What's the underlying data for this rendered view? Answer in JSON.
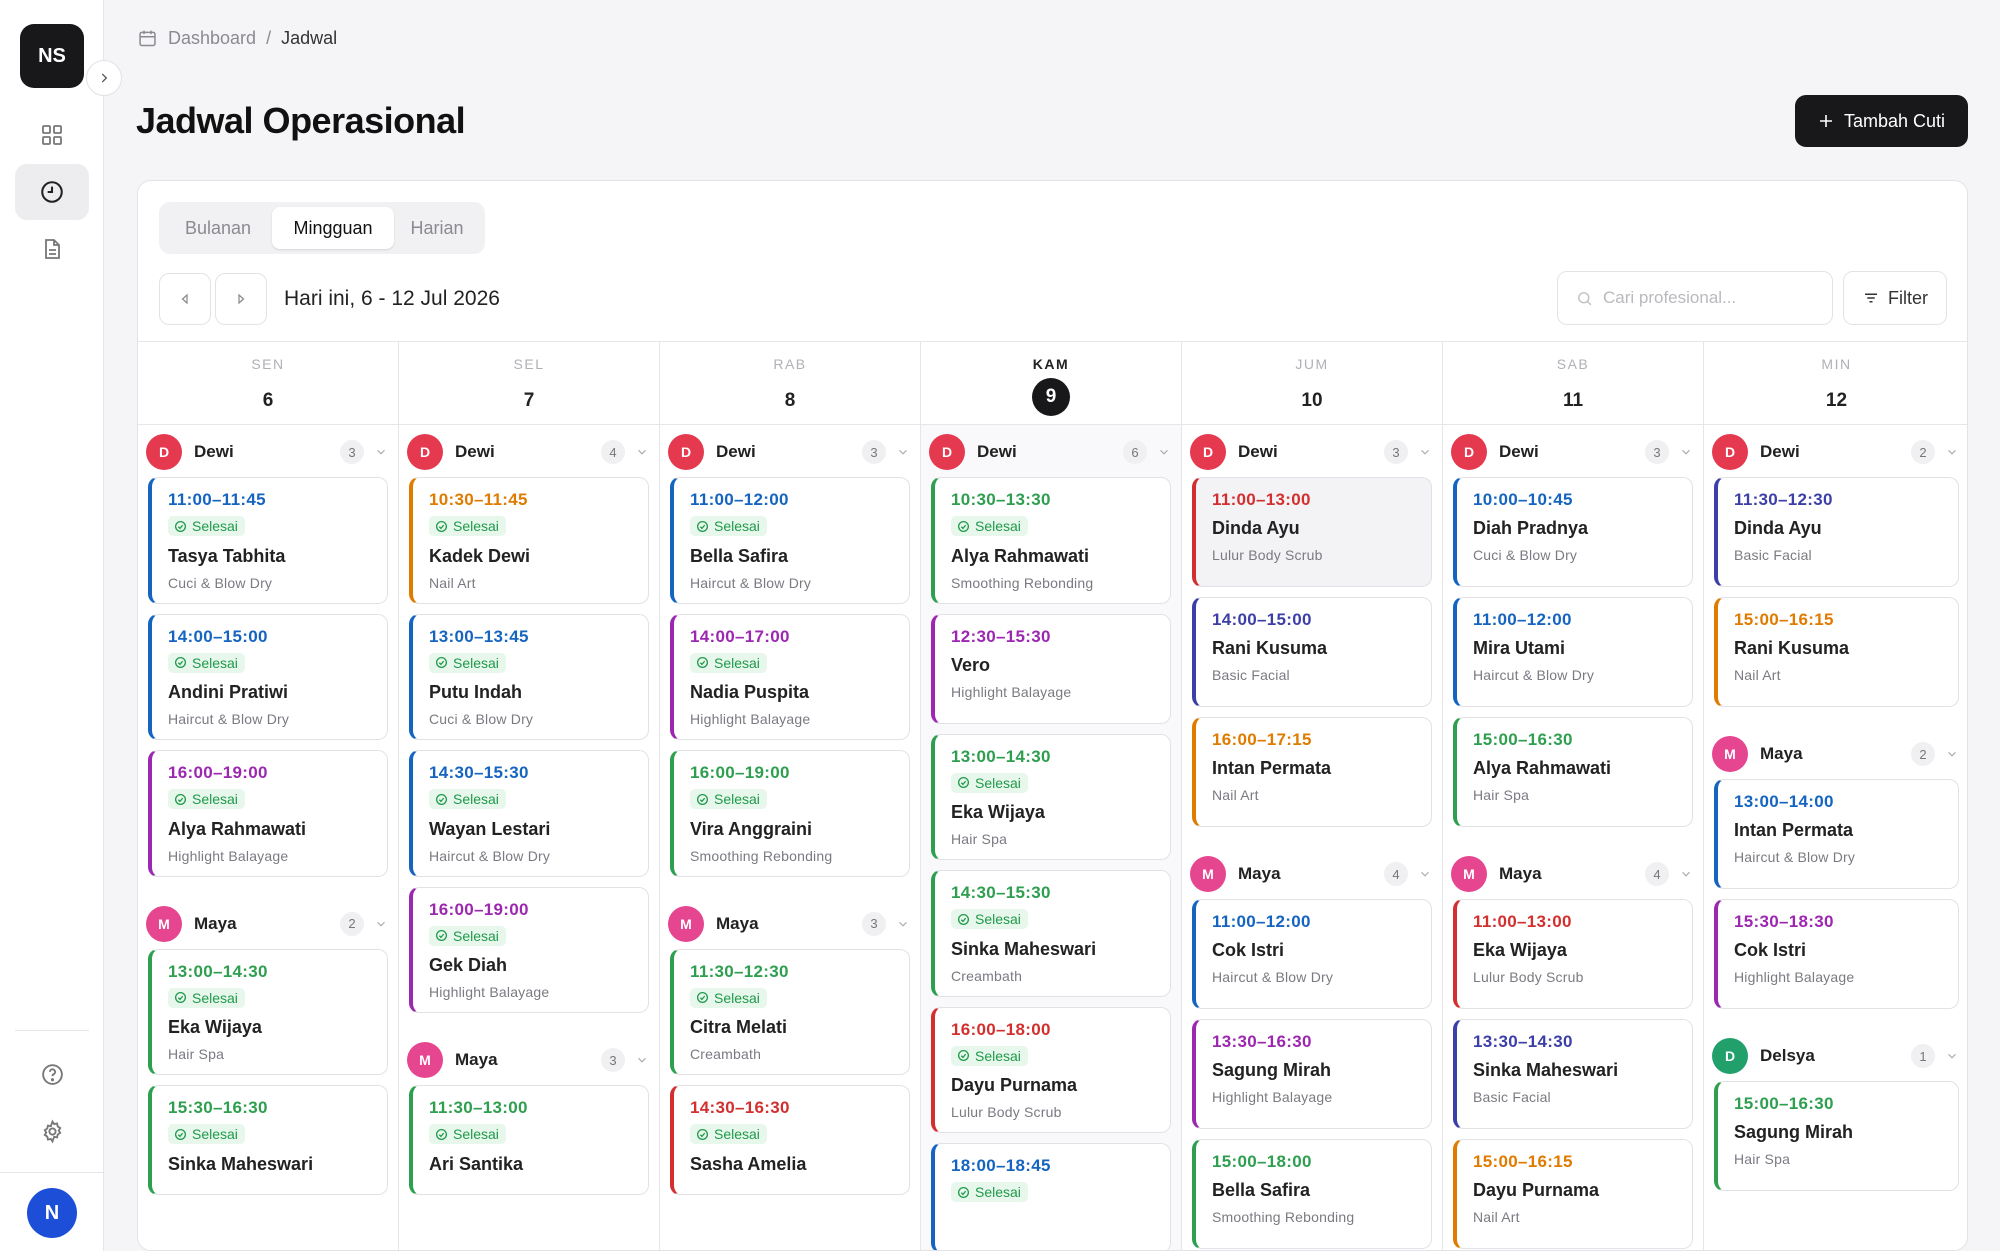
{
  "app": {
    "initials": "NS",
    "user_initial": "N"
  },
  "breadcrumb": {
    "root": "Dashboard",
    "separator": "/",
    "current": "Jadwal"
  },
  "header": {
    "title": "Jadwal Operasional",
    "add_label": "Tambah Cuti"
  },
  "view_tabs": [
    {
      "label": "Bulanan",
      "active": false
    },
    {
      "label": "Mingguan",
      "active": true
    },
    {
      "label": "Harian",
      "active": false
    }
  ],
  "toolbar": {
    "range_label": "Hari ini, 6 - 12 Jul 2026",
    "search_placeholder": "Cari profesional...",
    "filter_label": "Filter"
  },
  "status_label": "Selesai",
  "colors": {
    "blue": "#1565c0",
    "orange": "#e07b00",
    "purple": "#9c27b0",
    "green": "#2e9e4f",
    "indigo": "#3d3fa8",
    "red": "#d32f2f",
    "teal": "#1f8a6f",
    "avatar_dewi": "#e53950",
    "avatar_maya": "#e6458f",
    "avatar_delsya": "#22a06b"
  },
  "days": [
    {
      "dow": "SEN",
      "num": "6",
      "today": false,
      "groups": [
        {
          "name": "Dewi",
          "initial": "D",
          "count": "3",
          "avatar": "avatar_dewi",
          "items": [
            {
              "time": "11:00–11:45",
              "status": true,
              "client": "Tasya Tabhita",
              "service": "Cuci & Blow Dry",
              "color": "blue"
            },
            {
              "time": "14:00–15:00",
              "status": true,
              "client": "Andini Pratiwi",
              "service": "Haircut & Blow Dry",
              "color": "blue"
            },
            {
              "time": "16:00–19:00",
              "status": true,
              "client": "Alya Rahmawati",
              "service": "Highlight Balayage",
              "color": "purple"
            }
          ]
        },
        {
          "name": "Maya",
          "initial": "M",
          "count": "2",
          "avatar": "avatar_maya",
          "items": [
            {
              "time": "13:00–14:30",
              "status": true,
              "client": "Eka Wijaya",
              "service": "Hair Spa",
              "color": "green"
            },
            {
              "time": "15:30–16:30",
              "status": true,
              "client": "Sinka Maheswari",
              "service": "",
              "color": "green"
            }
          ]
        }
      ]
    },
    {
      "dow": "SEL",
      "num": "7",
      "today": false,
      "groups": [
        {
          "name": "Dewi",
          "initial": "D",
          "count": "4",
          "avatar": "avatar_dewi",
          "items": [
            {
              "time": "10:30–11:45",
              "status": true,
              "client": "Kadek Dewi",
              "service": "Nail Art",
              "color": "orange"
            },
            {
              "time": "13:00–13:45",
              "status": true,
              "client": "Putu Indah",
              "service": "Cuci & Blow Dry",
              "color": "blue"
            },
            {
              "time": "14:30–15:30",
              "status": true,
              "client": "Wayan Lestari",
              "service": "Haircut & Blow Dry",
              "color": "blue"
            },
            {
              "time": "16:00–19:00",
              "status": true,
              "client": "Gek Diah",
              "service": "Highlight Balayage",
              "color": "purple"
            }
          ]
        },
        {
          "name": "Maya",
          "initial": "M",
          "count": "3",
          "avatar": "avatar_maya",
          "items": [
            {
              "time": "11:30–13:00",
              "status": true,
              "client": "Ari Santika",
              "service": "",
              "color": "green"
            }
          ]
        }
      ]
    },
    {
      "dow": "RAB",
      "num": "8",
      "today": false,
      "groups": [
        {
          "name": "Dewi",
          "initial": "D",
          "count": "3",
          "avatar": "avatar_dewi",
          "items": [
            {
              "time": "11:00–12:00",
              "status": true,
              "client": "Bella Safira",
              "service": "Haircut & Blow Dry",
              "color": "blue"
            },
            {
              "time": "14:00–17:00",
              "status": true,
              "client": "Nadia Puspita",
              "service": "Highlight Balayage",
              "color": "purple"
            },
            {
              "time": "16:00–19:00",
              "status": true,
              "client": "Vira Anggraini",
              "service": "Smoothing Rebonding",
              "color": "green"
            }
          ]
        },
        {
          "name": "Maya",
          "initial": "M",
          "count": "3",
          "avatar": "avatar_maya",
          "items": [
            {
              "time": "11:30–12:30",
              "status": true,
              "client": "Citra Melati",
              "service": "Creambath",
              "color": "green"
            },
            {
              "time": "14:30–16:30",
              "status": true,
              "client": "Sasha Amelia",
              "service": "",
              "color": "red"
            }
          ]
        }
      ]
    },
    {
      "dow": "KAM",
      "num": "9",
      "today": true,
      "groups": [
        {
          "name": "Dewi",
          "initial": "D",
          "count": "6",
          "avatar": "avatar_dewi",
          "items": [
            {
              "time": "10:30–13:30",
              "status": true,
              "client": "Alya Rahmawati",
              "service": "Smoothing Rebonding",
              "color": "green"
            },
            {
              "time": "12:30–15:30",
              "status": false,
              "client": "Vero",
              "service": "Highlight Balayage",
              "color": "purple"
            },
            {
              "time": "13:00–14:30",
              "status": true,
              "client": "Eka Wijaya",
              "service": "Hair Spa",
              "color": "green"
            },
            {
              "time": "14:30–15:30",
              "status": true,
              "client": "Sinka Maheswari",
              "service": "Creambath",
              "color": "green"
            },
            {
              "time": "16:00–18:00",
              "status": true,
              "client": "Dayu Purnama",
              "service": "Lulur Body Scrub",
              "color": "red"
            },
            {
              "time": "18:00–18:45",
              "status": true,
              "client": "",
              "service": "",
              "color": "blue"
            }
          ]
        }
      ]
    },
    {
      "dow": "JUM",
      "num": "10",
      "today": false,
      "groups": [
        {
          "name": "Dewi",
          "initial": "D",
          "count": "3",
          "avatar": "avatar_dewi",
          "items": [
            {
              "time": "11:00–13:00",
              "status": false,
              "client": "Dinda Ayu",
              "service": "Lulur Body Scrub",
              "color": "red",
              "dim": true
            },
            {
              "time": "14:00–15:00",
              "status": false,
              "client": "Rani Kusuma",
              "service": "Basic Facial",
              "color": "indigo"
            },
            {
              "time": "16:00–17:15",
              "status": false,
              "client": "Intan Permata",
              "service": "Nail Art",
              "color": "orange"
            }
          ]
        },
        {
          "name": "Maya",
          "initial": "M",
          "count": "4",
          "avatar": "avatar_maya",
          "items": [
            {
              "time": "11:00–12:00",
              "status": false,
              "client": "Cok Istri",
              "service": "Haircut & Blow Dry",
              "color": "blue"
            },
            {
              "time": "13:30–16:30",
              "status": false,
              "client": "Sagung Mirah",
              "service": "Highlight Balayage",
              "color": "purple"
            },
            {
              "time": "15:00–18:00",
              "status": false,
              "client": "Bella Safira",
              "service": "Smoothing Rebonding",
              "color": "green"
            }
          ]
        }
      ]
    },
    {
      "dow": "SAB",
      "num": "11",
      "today": false,
      "groups": [
        {
          "name": "Dewi",
          "initial": "D",
          "count": "3",
          "avatar": "avatar_dewi",
          "items": [
            {
              "time": "10:00–10:45",
              "status": false,
              "client": "Diah Pradnya",
              "service": "Cuci & Blow Dry",
              "color": "blue"
            },
            {
              "time": "11:00–12:00",
              "status": false,
              "client": "Mira Utami",
              "service": "Haircut & Blow Dry",
              "color": "blue"
            },
            {
              "time": "15:00–16:30",
              "status": false,
              "client": "Alya Rahmawati",
              "service": "Hair Spa",
              "color": "green"
            }
          ]
        },
        {
          "name": "Maya",
          "initial": "M",
          "count": "4",
          "avatar": "avatar_maya",
          "items": [
            {
              "time": "11:00–13:00",
              "status": false,
              "client": "Eka Wijaya",
              "service": "Lulur Body Scrub",
              "color": "red"
            },
            {
              "time": "13:30–14:30",
              "status": false,
              "client": "Sinka Maheswari",
              "service": "Basic Facial",
              "color": "indigo"
            },
            {
              "time": "15:00–16:15",
              "status": false,
              "client": "Dayu Purnama",
              "service": "Nail Art",
              "color": "orange"
            }
          ]
        }
      ]
    },
    {
      "dow": "MIN",
      "num": "12",
      "today": false,
      "groups": [
        {
          "name": "Dewi",
          "initial": "D",
          "count": "2",
          "avatar": "avatar_dewi",
          "items": [
            {
              "time": "11:30–12:30",
              "status": false,
              "client": "Dinda Ayu",
              "service": "Basic Facial",
              "color": "indigo"
            },
            {
              "time": "15:00–16:15",
              "status": false,
              "client": "Rani Kusuma",
              "service": "Nail Art",
              "color": "orange"
            }
          ]
        },
        {
          "name": "Maya",
          "initial": "M",
          "count": "2",
          "avatar": "avatar_maya",
          "items": [
            {
              "time": "13:00–14:00",
              "status": false,
              "client": "Intan Permata",
              "service": "Haircut & Blow Dry",
              "color": "blue"
            },
            {
              "time": "15:30–18:30",
              "status": false,
              "client": "Cok Istri",
              "service": "Highlight Balayage",
              "color": "purple"
            }
          ]
        },
        {
          "name": "Delsya",
          "initial": "D",
          "count": "1",
          "avatar": "avatar_delsya",
          "items": [
            {
              "time": "15:00–16:30",
              "status": false,
              "client": "Sagung Mirah",
              "service": "Hair Spa",
              "color": "green"
            }
          ]
        }
      ]
    }
  ]
}
